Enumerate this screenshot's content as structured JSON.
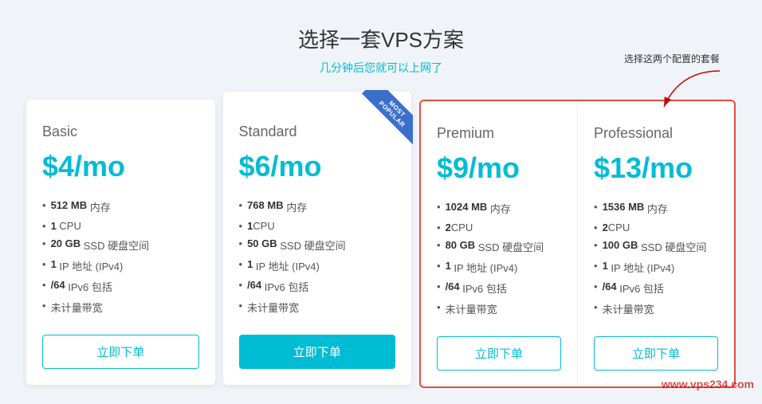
{
  "page": {
    "title": "选择一套VPS方案",
    "subtitle": "几分钟后您就可以上网了",
    "annotation": "选择这两个配置的套餐"
  },
  "plans": [
    {
      "id": "basic",
      "name": "Basic",
      "price": "$4/mo",
      "features": [
        {
          "bold": "512 MB",
          "text": " 内存"
        },
        {
          "bold": "1",
          "text": " CPU"
        },
        {
          "bold": "20 GB",
          "text": " SSD 硬盘空间"
        },
        {
          "bold": "1",
          "text": " IP 地址 (IPv4)"
        },
        {
          "bold": "/64",
          "text": " IPv6 包括"
        },
        {
          "bold": "",
          "text": "未计量带宽"
        }
      ],
      "button": "立即下单",
      "highlighted": false,
      "popular": false
    },
    {
      "id": "standard",
      "name": "Standard",
      "price": "$6/mo",
      "features": [
        {
          "bold": "768 MB",
          "text": " 内存"
        },
        {
          "bold": "1",
          "text": "CPU"
        },
        {
          "bold": "50 GB",
          "text": " SSD 硬盘空间"
        },
        {
          "bold": "1",
          "text": " IP 地址 (IPv4)"
        },
        {
          "bold": "/64",
          "text": " IPv6 包括"
        },
        {
          "bold": "",
          "text": "未计量带宽"
        }
      ],
      "button": "立即下单",
      "highlighted": false,
      "popular": true
    },
    {
      "id": "premium",
      "name": "Premium",
      "price": "$9/mo",
      "features": [
        {
          "bold": "1024 MB",
          "text": " 内存"
        },
        {
          "bold": "2",
          "text": "CPU"
        },
        {
          "bold": "80 GB",
          "text": " SSD 硬盘空间"
        },
        {
          "bold": "1",
          "text": " IP 地址 (IPv4)"
        },
        {
          "bold": "/64",
          "text": " IPv6 包括"
        },
        {
          "bold": "",
          "text": "未计量带宽"
        }
      ],
      "button": "立即下单",
      "highlighted": true,
      "popular": false
    },
    {
      "id": "professional",
      "name": "Professional",
      "price": "$13/mo",
      "features": [
        {
          "bold": "1536 MB",
          "text": " 内存"
        },
        {
          "bold": "2",
          "text": "CPU"
        },
        {
          "bold": "100 GB",
          "text": " SSD 硬盘空间"
        },
        {
          "bold": "1",
          "text": " IP 地址 (IPv4)"
        },
        {
          "bold": "/64",
          "text": " IPv6 包括"
        },
        {
          "bold": "",
          "text": "未计量带宽"
        }
      ],
      "button": "立即下单",
      "highlighted": true,
      "popular": false
    }
  ],
  "watermark": "www.vps234.com"
}
